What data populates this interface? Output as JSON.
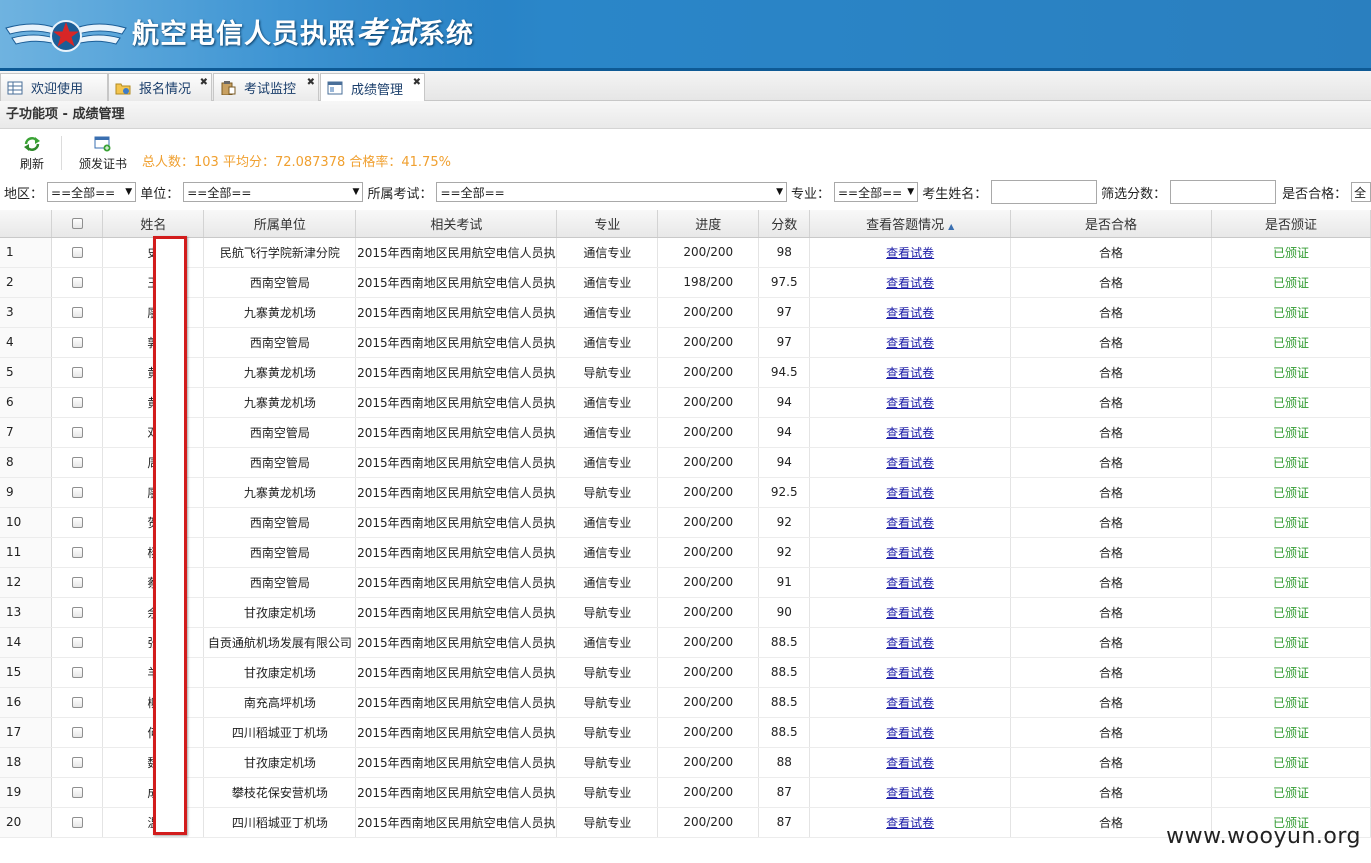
{
  "header": {
    "title": "航空电信人员执照",
    "title_script": "考试",
    "title_suffix": "系统"
  },
  "tabs": [
    {
      "label": "欢迎使用",
      "icon": "table-icon",
      "closable": false
    },
    {
      "label": "报名情况",
      "icon": "folder-icon",
      "closable": true
    },
    {
      "label": "考试监控",
      "icon": "clipboard-icon",
      "closable": true
    },
    {
      "label": "成绩管理",
      "icon": "window-icon",
      "closable": true,
      "active": true
    }
  ],
  "tab_close_glyph": "✖",
  "subbar": {
    "title": "子功能项 - 成绩管理"
  },
  "toolbar": {
    "refresh_label": "刷新",
    "issue_label": "颁发证书",
    "stats": "总人数：103 平均分：72.087378 合格率：41.75%"
  },
  "filters": {
    "region_label": "地区：",
    "region_value": "==全部==",
    "unit_label": "单位：",
    "unit_value": "==全部==",
    "exam_label": "所属考试：",
    "exam_value": "==全部==",
    "major_label": "专业：",
    "major_value": "==全部==",
    "name_label": "考生姓名：",
    "name_value": "",
    "score_label": "筛选分数：",
    "score_value": "",
    "pass_label": "是否合格：",
    "pass_value": "全"
  },
  "grid": {
    "columns": [
      "",
      "姓名",
      "所属单位",
      "相关考试",
      "专业",
      "进度",
      "分数",
      "查看答题情况",
      "是否合格",
      "是否颁证"
    ],
    "sorted_column": "查看答题情况",
    "rows": [
      {
        "no": "1",
        "name": "史",
        "unit": "民航飞行学院新津分院",
        "exam": "2015年西南地区民用航空电信人员执",
        "major": "通信专业",
        "progress": "200/200",
        "score": "98",
        "view": "查看试卷",
        "pass": "合格",
        "cert": "已颁证"
      },
      {
        "no": "2",
        "name": "王",
        "unit": "西南空管局",
        "exam": "2015年西南地区民用航空电信人员执",
        "major": "通信专业",
        "progress": "198/200",
        "score": "97.5",
        "view": "查看试卷",
        "pass": "合格",
        "cert": "已颁证"
      },
      {
        "no": "3",
        "name": "廖",
        "unit": "九寨黄龙机场",
        "exam": "2015年西南地区民用航空电信人员执",
        "major": "通信专业",
        "progress": "200/200",
        "score": "97",
        "view": "查看试卷",
        "pass": "合格",
        "cert": "已颁证"
      },
      {
        "no": "4",
        "name": "郭",
        "unit": "西南空管局",
        "exam": "2015年西南地区民用航空电信人员执",
        "major": "通信专业",
        "progress": "200/200",
        "score": "97",
        "view": "查看试卷",
        "pass": "合格",
        "cert": "已颁证"
      },
      {
        "no": "5",
        "name": "黄",
        "unit": "九寨黄龙机场",
        "exam": "2015年西南地区民用航空电信人员执",
        "major": "导航专业",
        "progress": "200/200",
        "score": "94.5",
        "view": "查看试卷",
        "pass": "合格",
        "cert": "已颁证"
      },
      {
        "no": "6",
        "name": "黄",
        "unit": "九寨黄龙机场",
        "exam": "2015年西南地区民用航空电信人员执",
        "major": "通信专业",
        "progress": "200/200",
        "score": "94",
        "view": "查看试卷",
        "pass": "合格",
        "cert": "已颁证"
      },
      {
        "no": "7",
        "name": "邓",
        "unit": "西南空管局",
        "exam": "2015年西南地区民用航空电信人员执",
        "major": "通信专业",
        "progress": "200/200",
        "score": "94",
        "view": "查看试卷",
        "pass": "合格",
        "cert": "已颁证"
      },
      {
        "no": "8",
        "name": "周",
        "unit": "西南空管局",
        "exam": "2015年西南地区民用航空电信人员执",
        "major": "通信专业",
        "progress": "200/200",
        "score": "94",
        "view": "查看试卷",
        "pass": "合格",
        "cert": "已颁证"
      },
      {
        "no": "9",
        "name": "廖",
        "unit": "九寨黄龙机场",
        "exam": "2015年西南地区民用航空电信人员执",
        "major": "导航专业",
        "progress": "200/200",
        "score": "92.5",
        "view": "查看试卷",
        "pass": "合格",
        "cert": "已颁证"
      },
      {
        "no": "10",
        "name": "贺",
        "unit": "西南空管局",
        "exam": "2015年西南地区民用航空电信人员执",
        "major": "通信专业",
        "progress": "200/200",
        "score": "92",
        "view": "查看试卷",
        "pass": "合格",
        "cert": "已颁证"
      },
      {
        "no": "11",
        "name": "杨",
        "unit": "西南空管局",
        "exam": "2015年西南地区民用航空电信人员执",
        "major": "通信专业",
        "progress": "200/200",
        "score": "92",
        "view": "查看试卷",
        "pass": "合格",
        "cert": "已颁证"
      },
      {
        "no": "12",
        "name": "蔡",
        "unit": "西南空管局",
        "exam": "2015年西南地区民用航空电信人员执",
        "major": "通信专业",
        "progress": "200/200",
        "score": "91",
        "view": "查看试卷",
        "pass": "合格",
        "cert": "已颁证"
      },
      {
        "no": "13",
        "name": "余",
        "unit": "甘孜康定机场",
        "exam": "2015年西南地区民用航空电信人员执",
        "major": "导航专业",
        "progress": "200/200",
        "score": "90",
        "view": "查看试卷",
        "pass": "合格",
        "cert": "已颁证"
      },
      {
        "no": "14",
        "name": "张",
        "unit": "自贡通航机场发展有限公司",
        "exam": "2015年西南地区民用航空电信人员执",
        "major": "通信专业",
        "progress": "200/200",
        "score": "88.5",
        "view": "查看试卷",
        "pass": "合格",
        "cert": "已颁证"
      },
      {
        "no": "15",
        "name": "羊",
        "unit": "甘孜康定机场",
        "exam": "2015年西南地区民用航空电信人员执",
        "major": "导航专业",
        "progress": "200/200",
        "score": "88.5",
        "view": "查看试卷",
        "pass": "合格",
        "cert": "已颁证"
      },
      {
        "no": "16",
        "name": "柳",
        "unit": "南充高坪机场",
        "exam": "2015年西南地区民用航空电信人员执",
        "major": "导航专业",
        "progress": "200/200",
        "score": "88.5",
        "view": "查看试卷",
        "pass": "合格",
        "cert": "已颁证"
      },
      {
        "no": "17",
        "name": "何",
        "unit": "四川稻城亚丁机场",
        "exam": "2015年西南地区民用航空电信人员执",
        "major": "导航专业",
        "progress": "200/200",
        "score": "88.5",
        "view": "查看试卷",
        "pass": "合格",
        "cert": "已颁证"
      },
      {
        "no": "18",
        "name": "魏",
        "unit": "甘孜康定机场",
        "exam": "2015年西南地区民用航空电信人员执",
        "major": "导航专业",
        "progress": "200/200",
        "score": "88",
        "view": "查看试卷",
        "pass": "合格",
        "cert": "已颁证"
      },
      {
        "no": "19",
        "name": "成",
        "unit": "攀枝花保安营机场",
        "exam": "2015年西南地区民用航空电信人员执",
        "major": "导航专业",
        "progress": "200/200",
        "score": "87",
        "view": "查看试卷",
        "pass": "合格",
        "cert": "已颁证"
      },
      {
        "no": "20",
        "name": "温",
        "unit": "四川稻城亚丁机场",
        "exam": "2015年西南地区民用航空电信人员执",
        "major": "导航专业",
        "progress": "200/200",
        "score": "87",
        "view": "查看试卷",
        "pass": "合格",
        "cert": "已颁证"
      }
    ]
  },
  "watermark": "www.wooyun.org",
  "colors": {
    "banner": "#2a86c9",
    "stats_text": "#f0a030",
    "link": "#1a1aa6",
    "issued": "#2f9a2f",
    "redaction_border": "#d21c1c"
  }
}
